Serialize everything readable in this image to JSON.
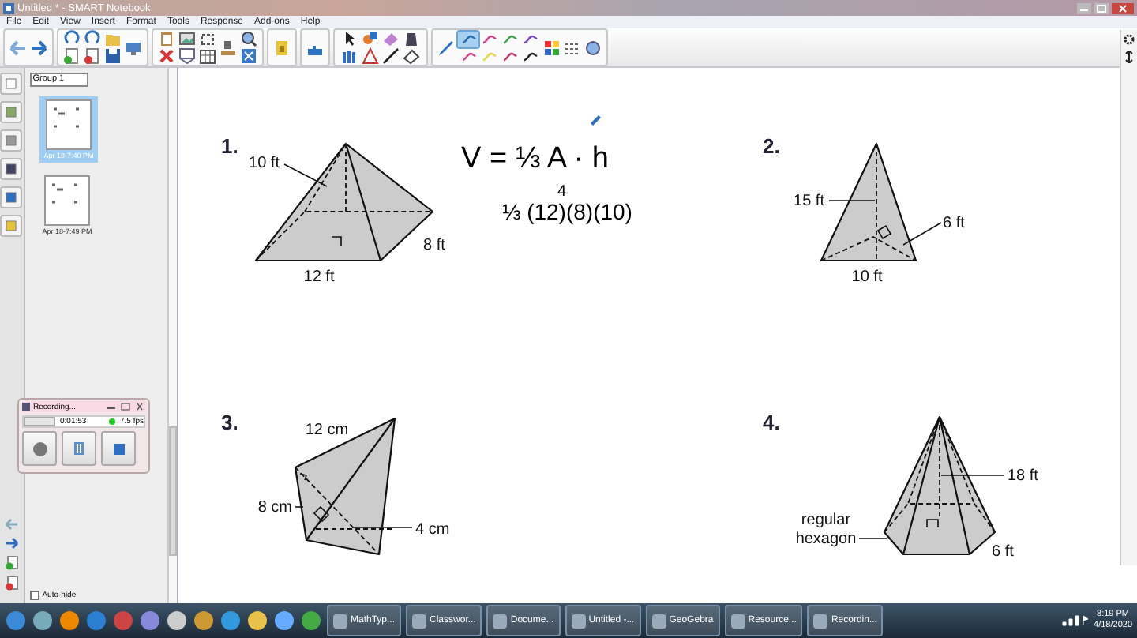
{
  "window": {
    "title": "Untitled * - SMART Notebook"
  },
  "menu": [
    "File",
    "Edit",
    "View",
    "Insert",
    "Format",
    "Tools",
    "Response",
    "Add-ons",
    "Help"
  ],
  "pen_styles": [
    {
      "color": "#2a6db0",
      "selected": true
    },
    {
      "color": "#d2408a",
      "selected": false
    },
    {
      "color": "#3fa34a",
      "selected": false
    },
    {
      "color": "#7a44c2",
      "selected": false
    },
    {
      "color": "#d2408a",
      "selected": false
    },
    {
      "color": "#e2d83a",
      "selected": false
    },
    {
      "color": "#c2306a",
      "selected": false
    },
    {
      "color": "#222222",
      "selected": false
    }
  ],
  "page_sorter": {
    "group": "Group 1",
    "pages": [
      {
        "time": "Apr 18-7:40 PM",
        "selected": true
      },
      {
        "time": "Apr 18-7:49 PM",
        "selected": false
      }
    ],
    "auto_hide": {
      "label": "Auto-hide",
      "checked": false
    }
  },
  "recorder": {
    "title": "Recording...",
    "elapsed": "0:01:53",
    "rate": "7.5 fps"
  },
  "page": {
    "problems": [
      {
        "kind": "square-pyramid",
        "number": "1.",
        "labels": [
          "10 ft",
          "12 ft",
          "8 ft"
        ]
      },
      {
        "kind": "triangle-pyramid",
        "number": "2.",
        "labels": [
          "15 ft",
          "6 ft",
          "10 ft"
        ]
      },
      {
        "kind": "kite-pyramid",
        "number": "3.",
        "labels": [
          "12 cm",
          "8 cm",
          "4 cm"
        ]
      },
      {
        "kind": "hexagon-pyramid",
        "number": "4.",
        "labels": [
          "18 ft",
          "regular",
          "hexagon",
          "6 ft"
        ]
      }
    ],
    "handwriting": [
      "V = ⅓ A · h",
      "⅓ (12)(8)(10)"
    ],
    "correction": "4"
  },
  "taskbar": {
    "items": [
      "MathTyp...",
      "Classwor...",
      "Docume...",
      "Untitled -...",
      "GeoGebra",
      "Resource...",
      "Recordin..."
    ],
    "time": "8:19 PM",
    "date": "4/18/2020"
  }
}
